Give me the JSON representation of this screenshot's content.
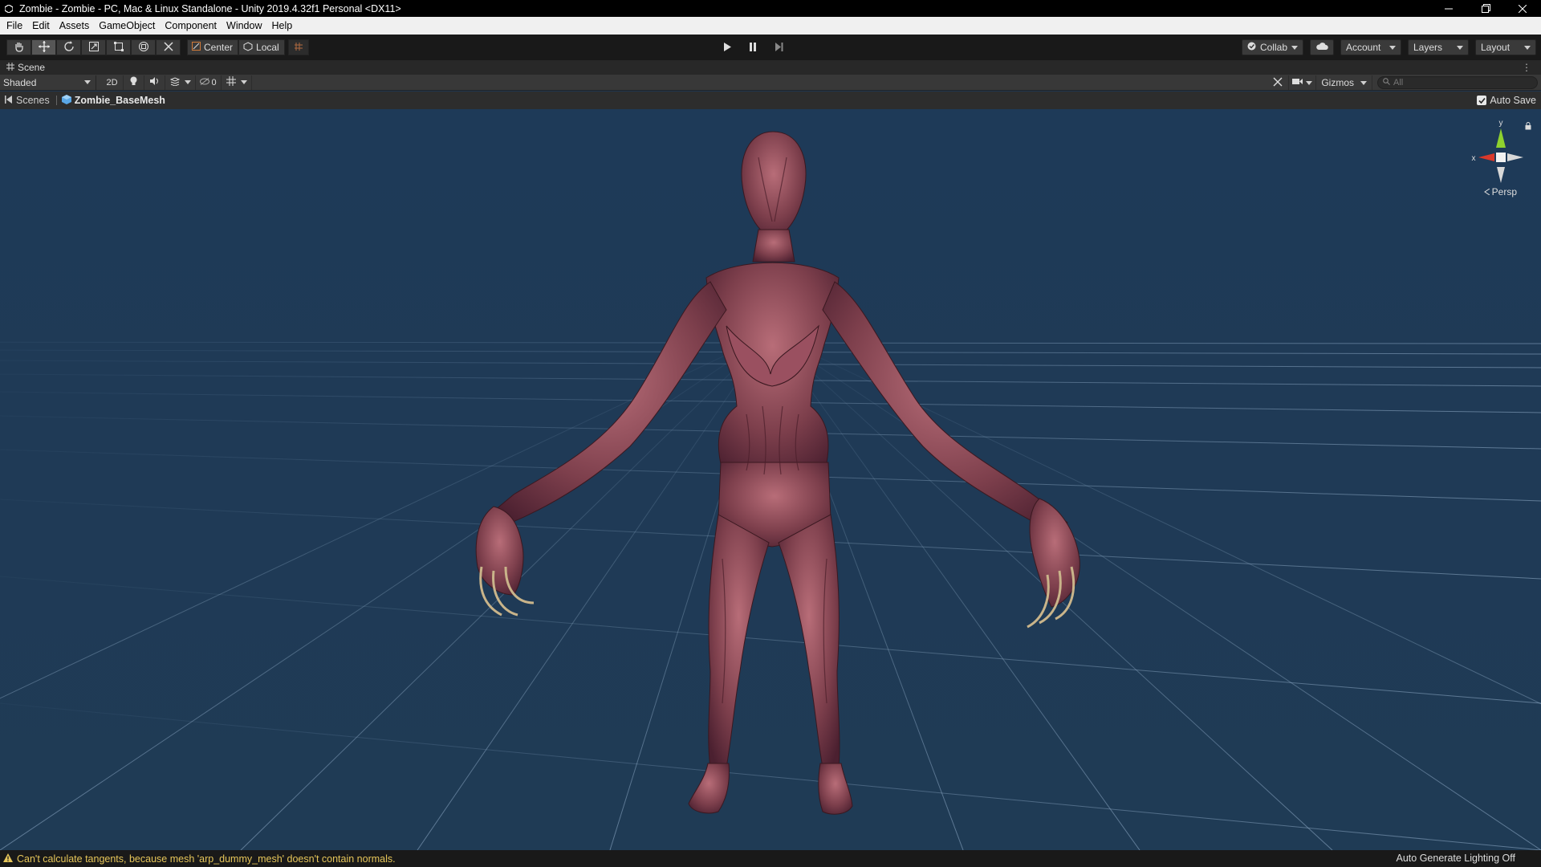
{
  "window": {
    "title": "Zombie - Zombie - PC, Mac & Linux Standalone - Unity 2019.4.32f1 Personal <DX11>",
    "controls": [
      "minimize",
      "restore",
      "close"
    ]
  },
  "menu": [
    "File",
    "Edit",
    "Assets",
    "GameObject",
    "Component",
    "Window",
    "Help"
  ],
  "toolbar": {
    "tools": [
      "hand-tool",
      "move-tool",
      "rotate-tool",
      "scale-tool",
      "rect-tool",
      "transform-tool",
      "custom-tool"
    ],
    "active_tool": "move-tool",
    "pivot_label": "Center",
    "space_label": "Local",
    "collab_label": "Collab",
    "account_label": "Account",
    "layers_label": "Layers",
    "layout_label": "Layout"
  },
  "scene_tab": {
    "label": "Scene"
  },
  "scene_toolbar": {
    "shading_mode": "Shaded",
    "mode_2d": "2D",
    "hidden_count": "0",
    "gizmos_label": "Gizmos",
    "search_placeholder": "All"
  },
  "breadcrumb": {
    "root": "Scenes",
    "current": "Zombie_BaseMesh"
  },
  "auto_save": {
    "label": "Auto Save",
    "checked": true
  },
  "orientation_gizmo": {
    "x_label": "x",
    "y_label": "y",
    "projection": "Persp"
  },
  "viewport": {
    "content": "zombie-character-mesh",
    "background": "#1f3a56",
    "skin_color": "#8a4a55"
  },
  "status": {
    "message": "Can't calculate tangents, because mesh 'arp_dummy_mesh' doesn't contain normals.",
    "message_color": "#e6c65a",
    "right_text": "Auto Generate Lighting Off"
  }
}
